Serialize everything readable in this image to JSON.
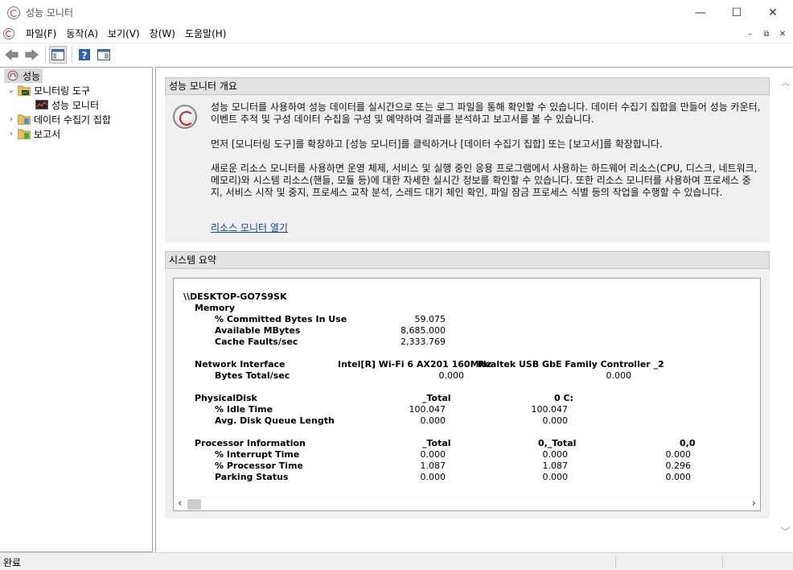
{
  "window": {
    "title": "성능 모니터",
    "minimize": "—",
    "maximize": "☐",
    "close": "✕"
  },
  "menu": {
    "items": [
      "파일(F)",
      "동작(A)",
      "보기(V)",
      "창(W)",
      "도움말(H)"
    ],
    "mdi_min": "–",
    "mdi_restore": "⧉",
    "mdi_close": "✕"
  },
  "toolbar": {
    "icons": [
      "back-arrow-icon",
      "forward-arrow-icon",
      "show-hide-tree-icon",
      "help-icon",
      "properties-icon"
    ]
  },
  "tree": {
    "root": "성능",
    "monitoring_tools": "모니터링 도구",
    "performance_monitor": "성능 모니터",
    "data_collector_sets": "데이터 수집기 집합",
    "reports": "보고서"
  },
  "overview": {
    "header": "성능 모니터 개요",
    "para1": "성능 모니터를 사용하여 성능 데이터를 실시간으로 또는 로그 파일을 통해 확인할 수 있습니다. 데이터 수집기 집합을 만들어 성능 카운터, 이벤트 추적 및 구성 데이터 수집을 구성 및 예약하여 결과를 분석하고 보고서를 볼 수 있습니다.",
    "para2": "먼저 [모니터링 도구]를 확장하고 [성능 모니터]를 클릭하거나 [데이터 수집기 집합] 또는 [보고서]를 확장합니다.",
    "para3": "새로운 리소스 모니터를 사용하면 운영 체제, 서비스 및 실행 중인 응용 프로그램에서 사용하는 하드웨어 리소스(CPU, 디스크, 네트워크,메모리)와 시스템 리소스(핸들, 모듈 등)에 대한 자세한 실시간 정보를 확인할 수 있습니다. 또한 리소스 모니터를 사용하여 프로세스 중지, 서비스 시작 및 중지, 프로세스 교착 분석, 스레드 대기 체인 확인, 파일 잠금 프로세스 식별 등의 작업을 수행할 수 있습니다.",
    "link": "리소스 모니터 열기"
  },
  "summary": {
    "header": "시스템 요약",
    "host": "\\\\DESKTOP-GO7S9SK",
    "memory": {
      "title": "Memory",
      "rows": [
        {
          "label": "% Committed Bytes In Use",
          "value": "59.075"
        },
        {
          "label": "Available MBytes",
          "value": "8,685.000"
        },
        {
          "label": "Cache Faults/sec",
          "value": "2,333.769"
        }
      ]
    },
    "network": {
      "title": "Network Interface",
      "col1": "Intel[R] Wi-Fi 6 AX201 160MHz",
      "col2": "Realtek USB GbE Family Controller _2",
      "row_label": "Bytes Total/sec",
      "v1": "0.000",
      "v2": "0.000"
    },
    "disk": {
      "title": "PhysicalDisk",
      "col1": "_Total",
      "col2": "0 C:",
      "rows": [
        {
          "label": "% Idle Time",
          "v1": "100.047",
          "v2": "100.047"
        },
        {
          "label": "Avg. Disk Queue Length",
          "v1": "0.000",
          "v2": "0.000"
        }
      ]
    },
    "processor": {
      "title": "Processor Information",
      "col1": "_Total",
      "col2": "0,_Total",
      "col3": "0,0",
      "rows": [
        {
          "label": "% Interrupt Time",
          "v1": "0.000",
          "v2": "0.000",
          "v3": "0.000"
        },
        {
          "label": "% Processor Time",
          "v1": "1.087",
          "v2": "1.087",
          "v3": "0.296"
        },
        {
          "label": "Parking Status",
          "v1": "0.000",
          "v2": "0.000",
          "v3": "0.000"
        }
      ]
    },
    "scroll_left": "‹",
    "scroll_right": "›"
  },
  "status": {
    "text": "완료"
  }
}
